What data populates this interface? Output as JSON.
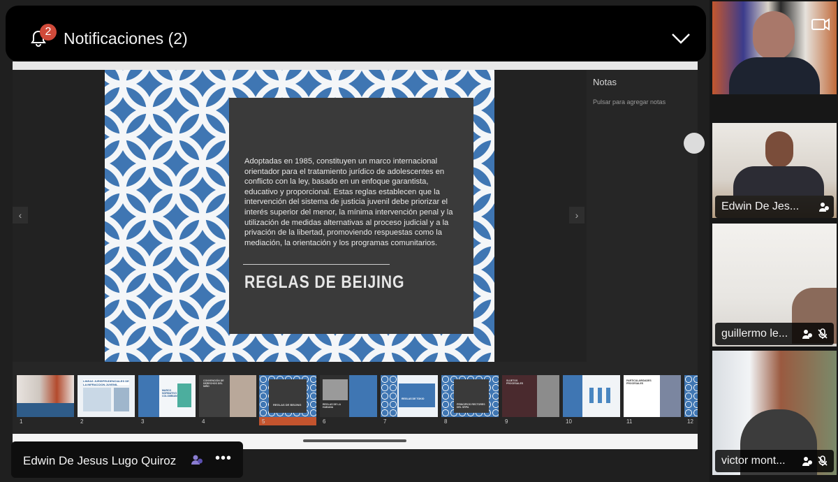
{
  "notification": {
    "badge": "2",
    "title": "Notificaciones (2)"
  },
  "slide": {
    "body": "Adoptadas en 1985, constituyen un marco internacional orientador para el tratamiento jurídico de adolescentes en conflicto con la ley, basado en un enfoque garantista, educativo y proporcional. Estas reglas establecen que la intervención del sistema de justicia juvenil debe priorizar el interés superior del menor, la mínima intervención penal y la utilización de medidas alternativas al proceso judicial y a la privación de la libertad, promoviendo respuestas como la mediación, la orientación y los programas comunitarios.",
    "heading": "REGLAS DE BEIJING"
  },
  "notes": {
    "title": "Notas",
    "placeholder": "Pulsar para agregar notas"
  },
  "thumbnails": [
    {
      "num": "1",
      "style": "photo"
    },
    {
      "num": "2",
      "title": "LINEAS JURISPRUDENCIALES DE LA INFRACCION JUVENIL",
      "style": "doc"
    },
    {
      "num": "3",
      "title": "MARCO NORMATIVO COLOMBIANO",
      "style": "bluegreen"
    },
    {
      "num": "4",
      "title": "CONVENCIÓN DE DERECHOS DEL NIÑO",
      "style": "dark"
    },
    {
      "num": "5",
      "title": "REGLAS DE BEIJING",
      "style": "pattern",
      "selected": true
    },
    {
      "num": "6",
      "title": "REGLAS DE LA HABANA",
      "style": "bw"
    },
    {
      "num": "7",
      "title": "REGLAS DE TOKIO",
      "style": "pattern-light"
    },
    {
      "num": "8",
      "title": "PRINCIPIOS RECTORES DEL SRPA",
      "style": "pattern"
    },
    {
      "num": "9",
      "title": "SUJETOS PROCESALES",
      "style": "maroon"
    },
    {
      "num": "10",
      "style": "icons"
    },
    {
      "num": "11",
      "title": "PARTICULARIDADES PROCESALES",
      "style": "white-photo"
    },
    {
      "num": "12",
      "style": "pattern"
    }
  ],
  "presenter": {
    "name": "Edwin De Jesus Lugo Quiroz",
    "more": "•••"
  },
  "participants": [
    {
      "name": ""
    },
    {
      "name": "Edwin De Jes..."
    },
    {
      "name": "guillermo le..."
    },
    {
      "name": "victor mont..."
    }
  ]
}
